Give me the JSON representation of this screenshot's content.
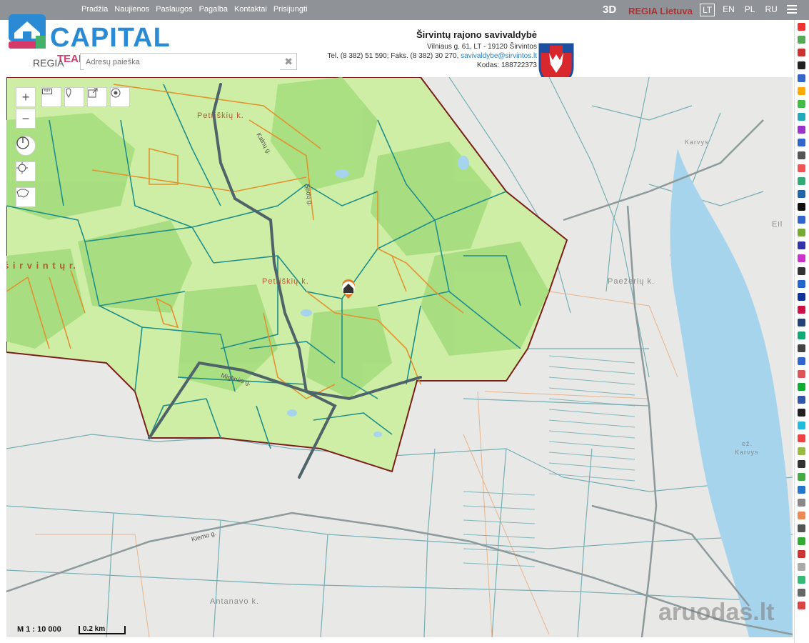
{
  "topbar": {
    "nav": [
      "Pradžia",
      "Naujienos",
      "Paslaugos",
      "Pagalba",
      "Kontaktai",
      "Prisijungti"
    ],
    "btn_3d": "3D",
    "regia_lietuva": "REGIA Lietuva",
    "languages": [
      "LT",
      "EN",
      "PL",
      "RU"
    ],
    "active_language": "LT"
  },
  "header": {
    "logo_capital": "CAPITAL",
    "logo_team": "TEAM",
    "regia": "REGIA",
    "search_placeholder": "Adresų paieška",
    "municipality": {
      "title": "Širvintų rajono savivaldybė",
      "address": "Vilniaus g. 61, LT - 19120 Širvintos",
      "phone": "Tel. (8 382) 51 590; Faks. (8 382) 30 270,",
      "email": "savivaldybe@sirvintos.lt",
      "code": "Kodas: 188722373"
    }
  },
  "map": {
    "places": {
      "petriskiu_top": "Petriškių k.",
      "petriskiu_mid": "Petriškių k.",
      "sirvintu": "š i r v i n t ų   r.",
      "paezeriu": "Paežerių k.",
      "karvys": "Karvys",
      "ez_karvys_1": "ež.",
      "ez_karvys_2": "Karvys",
      "antanavo": "Antanavo k.",
      "eiti": "Eil",
      "road_1": "Kalnų g.",
      "road_2": "Sodų g.",
      "road_3": "Miglinės g.",
      "road_4": "Kiemo g."
    },
    "scale_ratio": "M 1 : 10 000",
    "scale_bar": "0.2 km",
    "watermark": "aruodas.lt",
    "colors": {
      "municipality_fill": "#cfeea5",
      "forest": "#a8dd80",
      "parcel_line": "#1f8f8a",
      "plot_line": "#e0932e",
      "boundary": "#7a1f1a",
      "road": "#4f6468",
      "water": "#a6d4ec",
      "marker": "#e47a24"
    }
  }
}
